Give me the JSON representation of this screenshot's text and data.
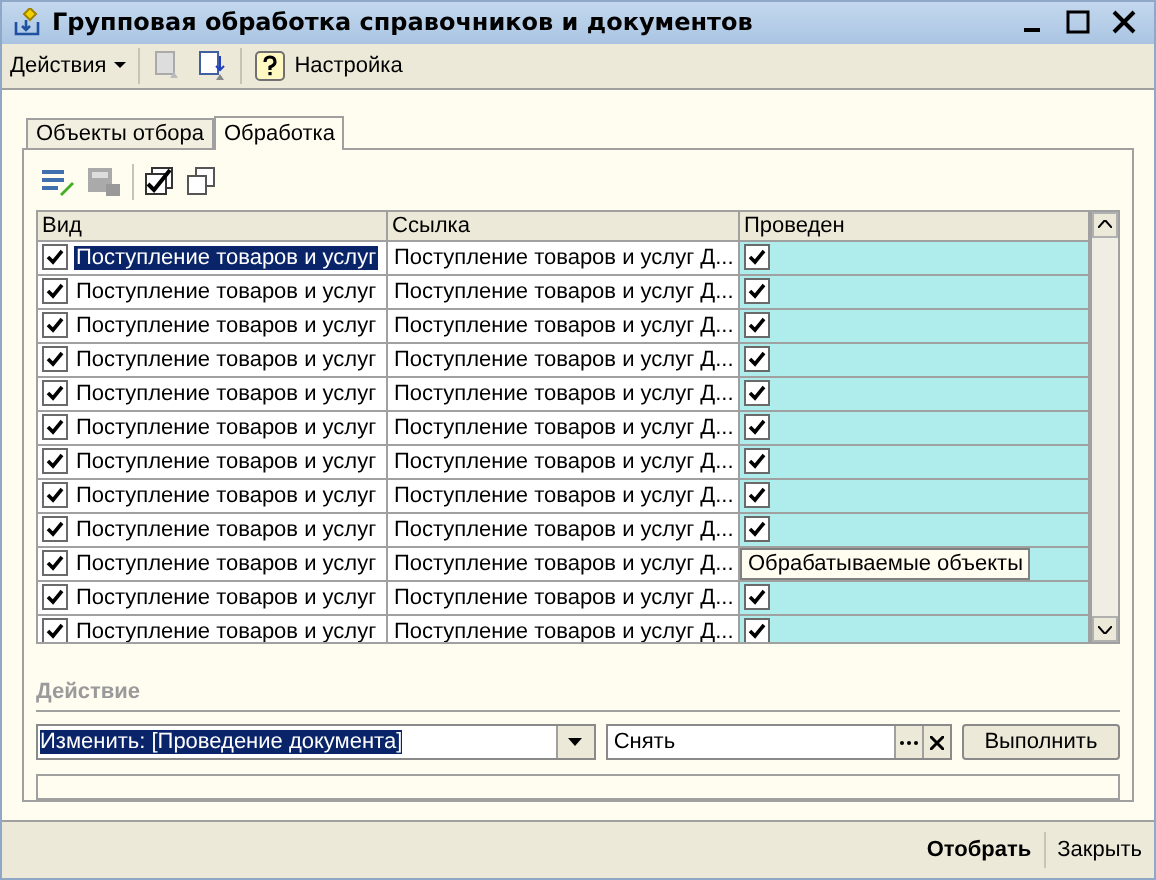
{
  "window": {
    "title": "Групповая обработка справочников и документов"
  },
  "toolbar": {
    "actions_menu": "Действия",
    "settings": "Настройка"
  },
  "tabs": [
    {
      "label": "Объекты отбора",
      "selected": false
    },
    {
      "label": "Обработка",
      "selected": true
    }
  ],
  "table": {
    "columns": [
      "Вид",
      "Ссылка",
      "Проведен"
    ],
    "rows": [
      {
        "checked": true,
        "kind": "Поступление товаров и услуг",
        "link": "Поступление товаров и услуг Д...",
        "posted": true,
        "selected": true
      },
      {
        "checked": true,
        "kind": "Поступление товаров и услуг",
        "link": "Поступление товаров и услуг Д...",
        "posted": true,
        "selected": false
      },
      {
        "checked": true,
        "kind": "Поступление товаров и услуг",
        "link": "Поступление товаров и услуг Д...",
        "posted": true,
        "selected": false
      },
      {
        "checked": true,
        "kind": "Поступление товаров и услуг",
        "link": "Поступление товаров и услуг Д...",
        "posted": true,
        "selected": false
      },
      {
        "checked": true,
        "kind": "Поступление товаров и услуг",
        "link": "Поступление товаров и услуг Д...",
        "posted": true,
        "selected": false
      },
      {
        "checked": true,
        "kind": "Поступление товаров и услуг",
        "link": "Поступление товаров и услуг Д...",
        "posted": true,
        "selected": false
      },
      {
        "checked": true,
        "kind": "Поступление товаров и услуг",
        "link": "Поступление товаров и услуг Д...",
        "posted": true,
        "selected": false
      },
      {
        "checked": true,
        "kind": "Поступление товаров и услуг",
        "link": "Поступление товаров и услуг Д...",
        "posted": true,
        "selected": false
      },
      {
        "checked": true,
        "kind": "Поступление товаров и услуг",
        "link": "Поступление товаров и услуг Д...",
        "posted": true,
        "selected": false
      },
      {
        "checked": true,
        "kind": "Поступление товаров и услуг",
        "link": "Поступление товаров и услуг Д...",
        "tooltip": "Обрабатываемые объекты",
        "selected": false
      },
      {
        "checked": true,
        "kind": "Поступление товаров и услуг",
        "link": "Поступление товаров и услуг Д...",
        "posted": true,
        "selected": false
      },
      {
        "checked": true,
        "kind": "Поступление товаров и услуг",
        "link": "Поступление товаров и услуг Д...",
        "posted": true,
        "selected": false
      }
    ]
  },
  "action": {
    "label": "Действие",
    "operation": "Изменить: [Проведение документа]",
    "value": "Снять",
    "run_button": "Выполнить",
    "progress": {
      "level": 0
    }
  },
  "footer": {
    "select_button": "Отобрать",
    "close_button": "Закрыть"
  }
}
